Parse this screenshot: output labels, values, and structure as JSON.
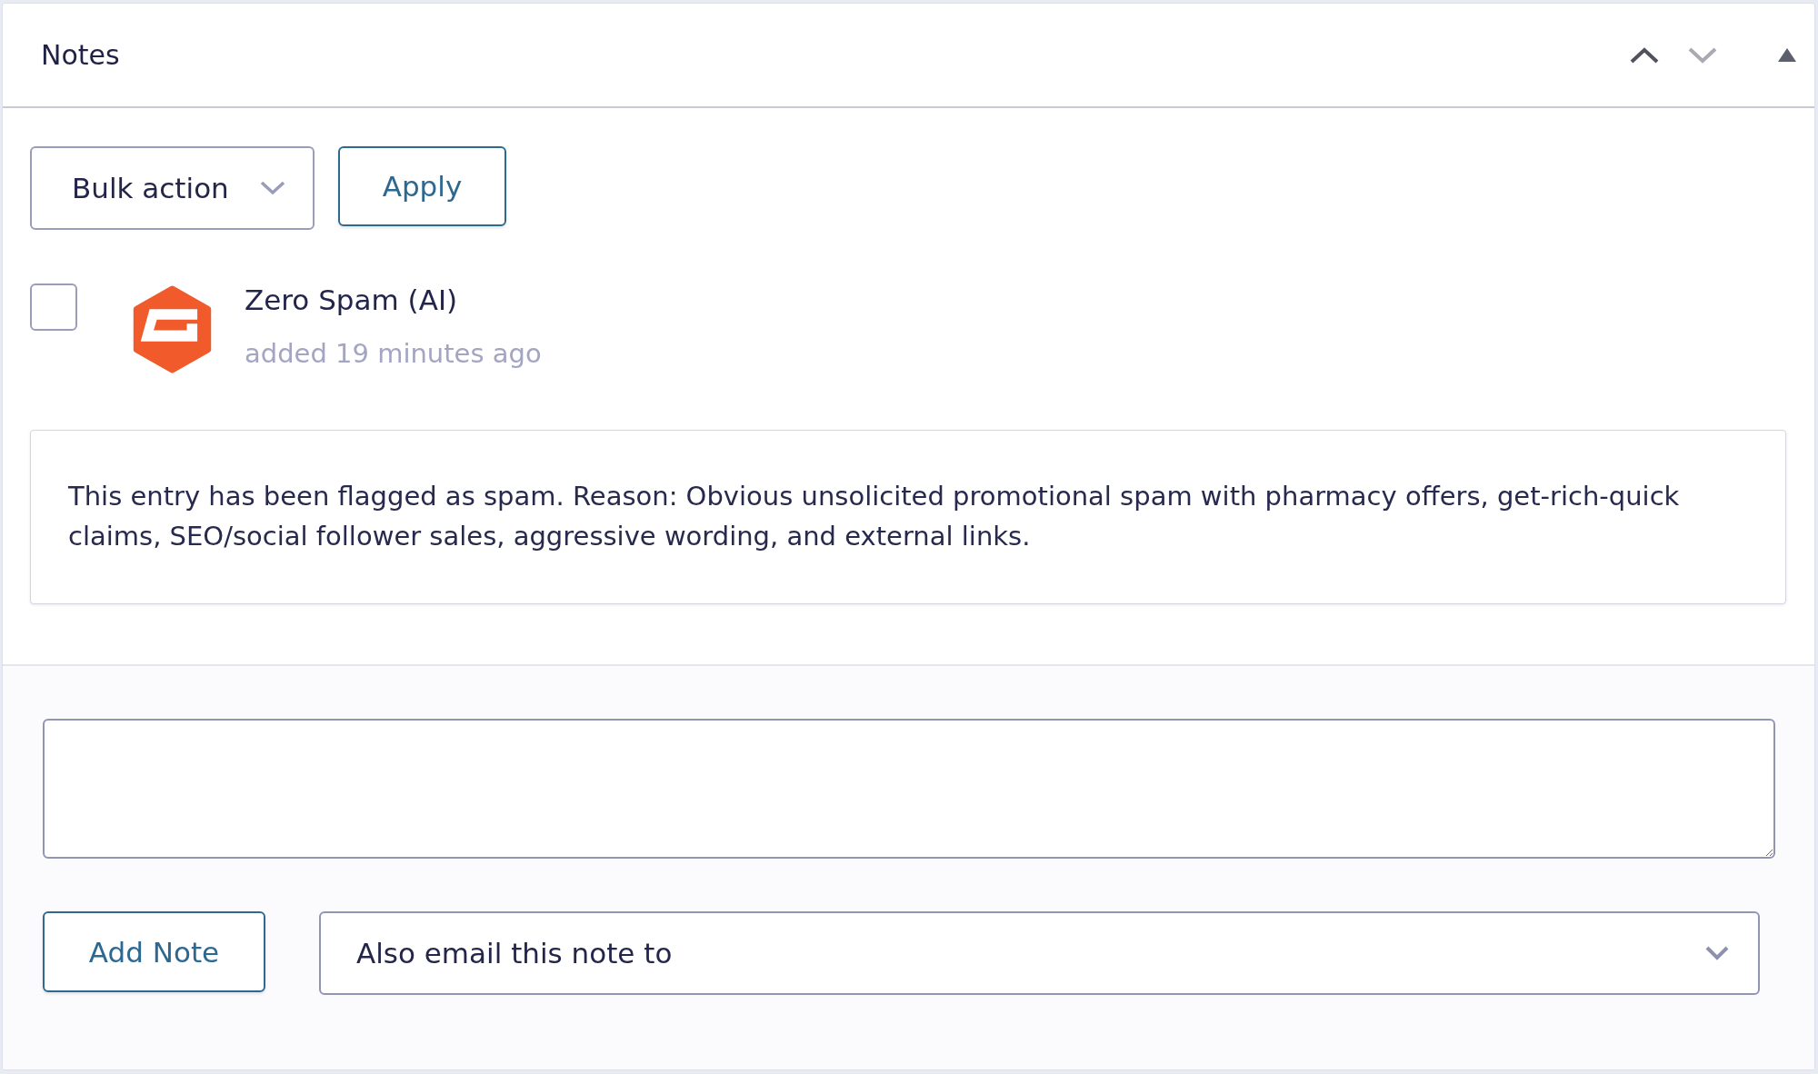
{
  "panel": {
    "title": "Notes",
    "header_buttons": [
      {
        "kind": "up",
        "disabled": false
      },
      {
        "kind": "down",
        "disabled": true
      }
    ],
    "expanded": true
  },
  "toolbar": {
    "bulk_action": {
      "value": "Bulk action"
    },
    "apply_button": "Apply"
  },
  "notes": [
    {
      "checked": false,
      "author": "Zero Spam (AI)",
      "time": "added 19 minutes ago",
      "text": "This entry has been flagged as spam. Reason: Obvious unsolicited promotional spam with pharmacy offers, get-rich-quick claims, SEO/social follower sales, aggressive wording, and external links."
    }
  ],
  "composer": {
    "add_note_button": "Add Note",
    "email_select": {
      "value": "Also email this note to"
    }
  }
}
